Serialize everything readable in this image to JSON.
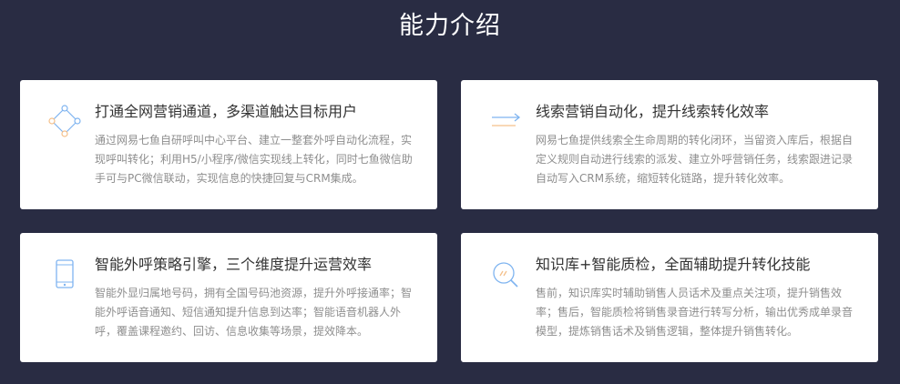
{
  "section": {
    "title": "能力介绍"
  },
  "cards": [
    {
      "icon": "channel-network-icon",
      "title": "打通全网营销通道，多渠道触达目标用户",
      "desc": "通过网易七鱼自研呼叫中心平台、建立一整套外呼自动化流程，实现呼叫转化；利用H5/小程序/微信实现线上转化，同时七鱼微信助手可与PC微信联动，实现信息的快捷回复与CRM集成。"
    },
    {
      "icon": "transfer-arrows-icon",
      "title": "线索营销自动化，提升线索转化效率",
      "desc": "网易七鱼提供线索全生命周期的转化闭环，当留资入库后，根据自定义规则自动进行线索的派发、建立外呼营销任务，线索跟进记录自动写入CRM系统，缩短转化链路，提升转化效率。"
    },
    {
      "icon": "mobile-phone-icon",
      "title": "智能外呼策略引擎，三个维度提升运营效率",
      "desc": "智能外显归属地号码，拥有全国号码池资源，提升外呼接通率；智能外呼语音通知、短信通知提升信息到达率；智能语音机器人外呼，覆盖课程邀约、回访、信息收集等场景，提效降本。"
    },
    {
      "icon": "quality-search-icon",
      "title": "知识库+智能质检，全面辅助提升转化技能",
      "desc": "售前，知识库实时辅助销售人员话术及重点关注项，提升销售效率；售后，智能质检将销售录音进行转写分析，输出优秀成单录音模型，提炼销售话术及销售逻辑，整体提升销售转化。"
    }
  ],
  "colors": {
    "background": "#292c43",
    "card": "#ffffff",
    "icon_primary": "#7fb4f0",
    "icon_accent": "#f5c08a"
  }
}
